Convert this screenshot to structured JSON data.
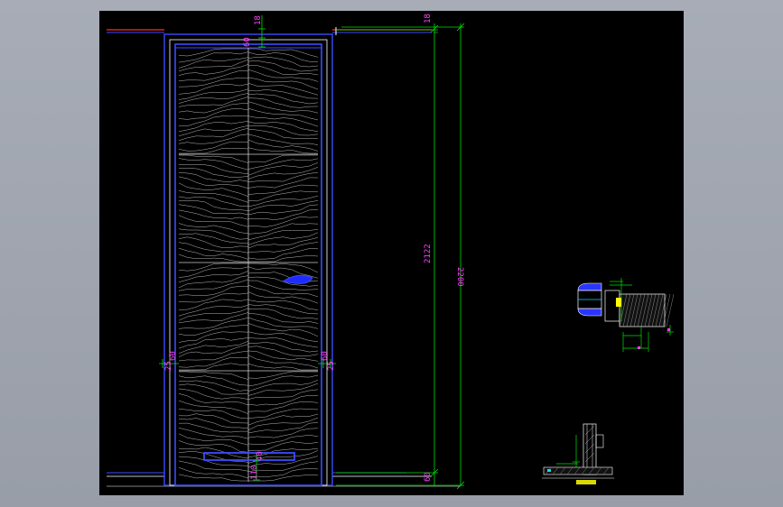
{
  "app": {
    "canvas_background": "#000000",
    "window_background": "#9ea3ad"
  },
  "colors": {
    "door_outline": "#2a35ff",
    "grain": "#d8d8d8",
    "dimension": "#00e000",
    "dimension_text": "#ff40ff",
    "wall_red": "#ff2a2a",
    "wall_blue": "#3a4bff",
    "detail_white": "#ffffff",
    "detail_cyan": "#00e0ff"
  },
  "dimensions": {
    "top_left_18": "18",
    "top_left_60": "60",
    "top_right_18": "18",
    "height_inner": "2122",
    "height_total": "2200",
    "bottom_right_60": "60",
    "left_side": "25",
    "left_side_60": "60",
    "right_side_60": "60",
    "right_side_25": "25",
    "bottom_small": "40",
    "bottom_small_2": "110"
  },
  "details": {
    "section_label_1": "",
    "section_label_2": ""
  }
}
